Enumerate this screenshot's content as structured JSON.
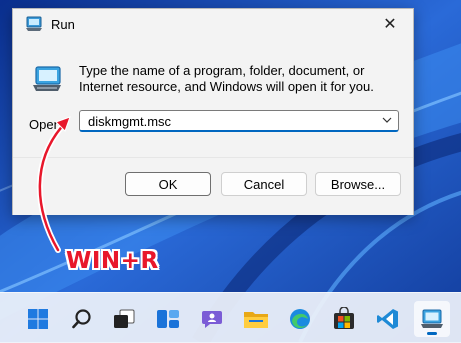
{
  "dialog": {
    "title": "Run",
    "description": "Type the name of a program, folder, document, or Internet resource, and Windows will open it for you.",
    "open_label": "Open:",
    "open_value": "diskmgmt.msc",
    "buttons": {
      "ok": "OK",
      "cancel": "Cancel",
      "browse": "Browse..."
    },
    "close_glyph": "✕"
  },
  "annotation": {
    "hotkey_text": "WIN+R"
  },
  "taskbar": {
    "items": [
      {
        "icon": "windows-start-icon"
      },
      {
        "icon": "search-icon"
      },
      {
        "icon": "task-view-icon"
      },
      {
        "icon": "widgets-icon"
      },
      {
        "icon": "teams-chat-icon"
      },
      {
        "icon": "file-explorer-icon"
      },
      {
        "icon": "edge-icon"
      },
      {
        "icon": "microsoft-store-icon"
      },
      {
        "icon": "vscode-icon"
      },
      {
        "icon": "run-icon"
      }
    ]
  },
  "colors": {
    "accent": "#0067c0",
    "hotkey": "#e8172b",
    "wallpaper": "#2b5fc8"
  }
}
